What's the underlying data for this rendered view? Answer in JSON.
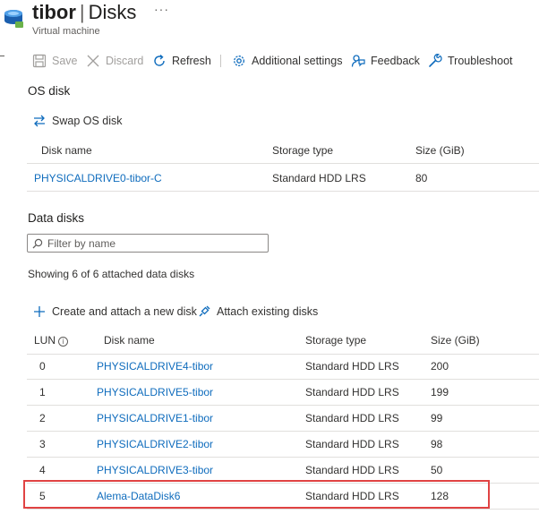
{
  "header": {
    "vm_name": "tibor",
    "separator": "|",
    "page_name": "Disks",
    "more": "···",
    "subtitle": "Virtual machine"
  },
  "toolbar": {
    "save": "Save",
    "discard": "Discard",
    "refresh": "Refresh",
    "additional_settings": "Additional settings",
    "feedback": "Feedback",
    "troubleshoot": "Troubleshoot"
  },
  "os_disk": {
    "title": "OS disk",
    "swap_label": "Swap OS disk",
    "columns": [
      "Disk name",
      "Storage type",
      "Size (GiB)"
    ],
    "row": {
      "name": "PHYSICALDRIVE0-tibor-C",
      "storage_type": "Standard HDD LRS",
      "size": "80"
    }
  },
  "data_disks": {
    "title": "Data disks",
    "filter_placeholder": "Filter by name",
    "showing_text": "Showing 6 of 6 attached data disks",
    "create_label": "Create and attach a new disk",
    "attach_label": "Attach existing disks",
    "columns": [
      "LUN",
      "Disk name",
      "Storage type",
      "Size (GiB)"
    ],
    "rows": [
      {
        "lun": "0",
        "name": "PHYSICALDRIVE4-tibor",
        "storage_type": "Standard HDD LRS",
        "size": "200"
      },
      {
        "lun": "1",
        "name": "PHYSICALDRIVE5-tibor",
        "storage_type": "Standard HDD LRS",
        "size": "199"
      },
      {
        "lun": "2",
        "name": "PHYSICALDRIVE1-tibor",
        "storage_type": "Standard HDD LRS",
        "size": "99"
      },
      {
        "lun": "3",
        "name": "PHYSICALDRIVE2-tibor",
        "storage_type": "Standard HDD LRS",
        "size": "98"
      },
      {
        "lun": "4",
        "name": "PHYSICALDRIVE3-tibor",
        "storage_type": "Standard HDD LRS",
        "size": "50"
      },
      {
        "lun": "5",
        "name": "Alema-DataDisk6",
        "storage_type": "Standard HDD LRS",
        "size": "128"
      }
    ]
  },
  "colors": {
    "link": "#0f6cbd",
    "highlight_border": "#e04343",
    "disabled_text": "#a19f9d"
  }
}
